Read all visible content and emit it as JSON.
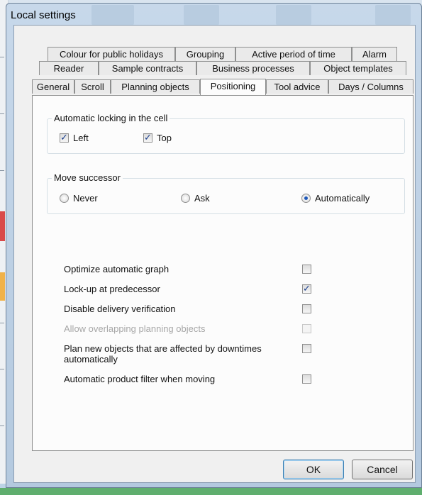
{
  "window": {
    "title": "Local settings"
  },
  "tabs": {
    "row1": [
      "Colour for public holidays",
      "Grouping",
      "Active period of time",
      "Alarm"
    ],
    "row2": [
      "Reader",
      "Sample contracts",
      "Business processes",
      "Object templates"
    ],
    "row3": [
      "General",
      "Scroll",
      "Planning objects",
      "Positioning",
      "Tool advice",
      "Days / Columns"
    ],
    "active": "Positioning"
  },
  "locking": {
    "title": "Automatic locking in the cell",
    "left": {
      "label": "Left",
      "checked": true
    },
    "top": {
      "label": "Top",
      "checked": true
    }
  },
  "successor": {
    "title": "Move successor",
    "options": [
      "Never",
      "Ask",
      "Automatically"
    ],
    "selected": "Automatically"
  },
  "options": [
    {
      "label": "Optimize automatic graph",
      "checked": false,
      "enabled": true
    },
    {
      "label": "Lock-up at predecessor",
      "checked": true,
      "enabled": true
    },
    {
      "label": "Disable delivery verification",
      "checked": false,
      "enabled": true
    },
    {
      "label": "Allow overlapping planning objects",
      "checked": false,
      "enabled": false
    },
    {
      "label": "Plan new objects that are affected by downtimes automatically",
      "checked": false,
      "enabled": true
    },
    {
      "label": "Automatic product filter when moving",
      "checked": false,
      "enabled": true
    }
  ],
  "buttons": {
    "ok": "OK",
    "cancel": "Cancel"
  },
  "icons": {
    "checked": "check-mark",
    "radio_selected": "radio-dot"
  },
  "colors": {
    "window_frame": "#b4c9df",
    "check": "#1b3f8c",
    "radio": "#1d57b8",
    "background_bar": "#5fae6e"
  }
}
